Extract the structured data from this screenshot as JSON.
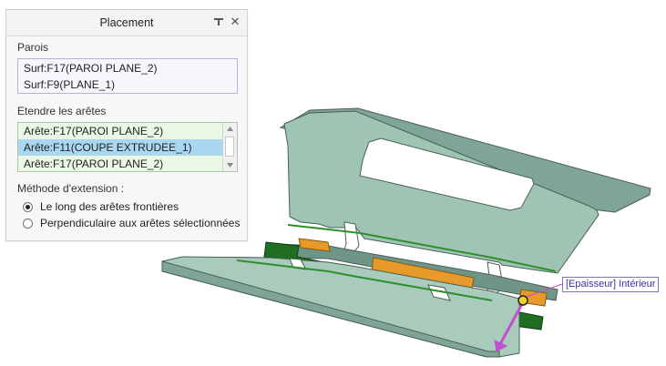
{
  "panel": {
    "title": "Placement",
    "walls": {
      "label": "Parois",
      "items": [
        "Surf:F17(PAROI PLANE_2)",
        "Surf:F9(PLANE_1)"
      ]
    },
    "edges": {
      "label": "Etendre les arêtes",
      "items": [
        "Arête:F17(PAROI PLANE_2)",
        "Arête:F11(COUPE EXTRUDEE_1)",
        "Arête:F17(PAROI PLANE_2)"
      ],
      "selected_index": 1
    },
    "method": {
      "label": "Méthode d'extension :",
      "options": [
        "Le long des arêtes frontières",
        "Perpendiculaire aux arêtes sélectionnées"
      ],
      "selected_index": 0
    }
  },
  "viewport": {
    "callout": "[Epaisseur] Intérieur"
  },
  "colors": {
    "part_face": "#9fc4b4",
    "part_edge": "#4a5f56",
    "part_dark": "#6f9587",
    "selected_green": "#2e8f2e",
    "orange_highlight": "#e79a2a",
    "arrow_magenta": "#c050d0",
    "list_selection": "#a9d7f2"
  }
}
